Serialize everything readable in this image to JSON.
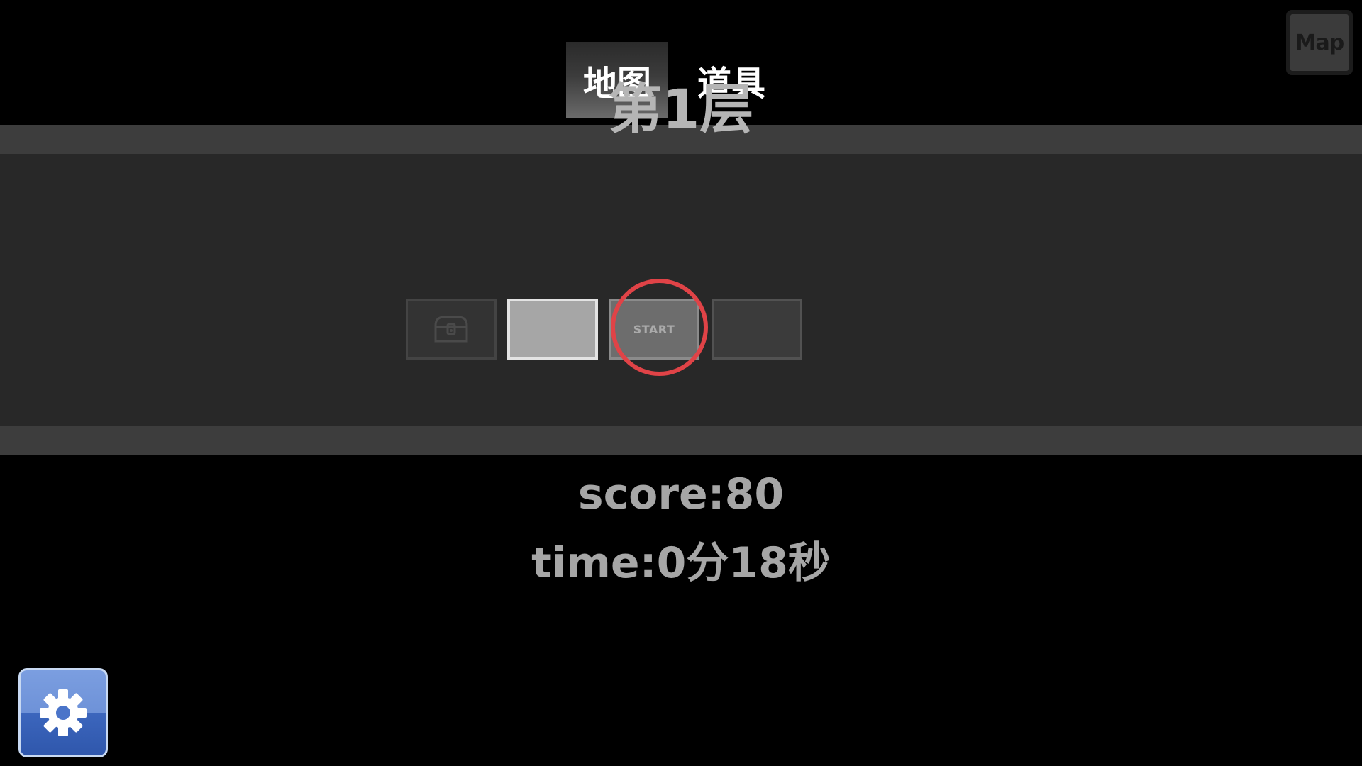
{
  "tabs": {
    "map_label": "地图",
    "items_label": "道具"
  },
  "map_button": {
    "label": "Map"
  },
  "floor": {
    "title": "第1层",
    "rooms": [
      {
        "type": "treasure",
        "icon": "treasure-chest-icon",
        "label": ""
      },
      {
        "type": "current",
        "label": ""
      },
      {
        "type": "start",
        "label": "START"
      },
      {
        "type": "unexplored",
        "label": ""
      }
    ]
  },
  "stats": {
    "score": "score:80",
    "time": "time:0分18秒"
  },
  "settings": {
    "icon": "gear-icon"
  },
  "colors": {
    "highlight_ring": "#e04347",
    "settings_button": "#4a74c9",
    "active_tab": "#5a5a5a"
  }
}
